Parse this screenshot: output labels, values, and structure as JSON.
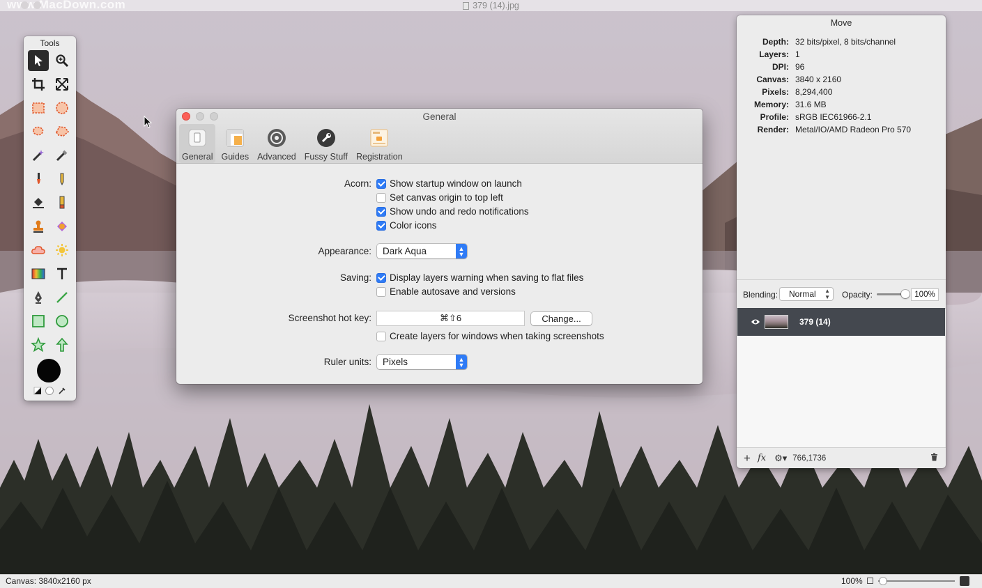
{
  "window": {
    "title": "379 (14).jpg",
    "watermark": "www.MacDown.com"
  },
  "tools": {
    "title": "Tools",
    "items": [
      {
        "name": "move-tool",
        "icon": "arrow-pointer-icon",
        "active": true
      },
      {
        "name": "zoom-tool",
        "icon": "magnifier-icon"
      },
      {
        "name": "crop-tool",
        "icon": "crop-icon"
      },
      {
        "name": "resize-tool",
        "icon": "expand-arrows-icon"
      },
      {
        "name": "rect-select-tool",
        "icon": "rect-selection-icon"
      },
      {
        "name": "ellipse-select-tool",
        "icon": "ellipse-selection-icon"
      },
      {
        "name": "lasso-tool",
        "icon": "lasso-icon"
      },
      {
        "name": "polygon-lasso-tool",
        "icon": "polygon-lasso-icon"
      },
      {
        "name": "magic-wand-tool",
        "icon": "magic-wand-icon"
      },
      {
        "name": "instant-alpha-tool",
        "icon": "wand-alpha-icon"
      },
      {
        "name": "brush-tool",
        "icon": "brush-icon"
      },
      {
        "name": "pencil-tool",
        "icon": "pencil-icon"
      },
      {
        "name": "paint-bucket-tool",
        "icon": "bucket-icon"
      },
      {
        "name": "eraser-tool",
        "icon": "eraser-icon"
      },
      {
        "name": "clone-stamp-tool",
        "icon": "stamp-icon"
      },
      {
        "name": "heal-tool",
        "icon": "bandage-icon"
      },
      {
        "name": "cloud-tool",
        "icon": "cloud-icon"
      },
      {
        "name": "dodge-burn-tool",
        "icon": "sun-icon"
      },
      {
        "name": "gradient-tool",
        "icon": "gradient-icon"
      },
      {
        "name": "text-tool",
        "icon": "text-icon"
      },
      {
        "name": "bezier-tool",
        "icon": "pen-nib-icon"
      },
      {
        "name": "line-tool",
        "icon": "line-icon"
      },
      {
        "name": "rect-shape-tool",
        "icon": "square-icon"
      },
      {
        "name": "oval-shape-tool",
        "icon": "circle-icon"
      },
      {
        "name": "star-tool",
        "icon": "star-icon"
      },
      {
        "name": "arrow-tool",
        "icon": "up-arrow-icon"
      }
    ],
    "foreground_color": "#050505"
  },
  "prefs": {
    "title": "General",
    "tabs": [
      {
        "label": "General",
        "icon": "general-switch-icon",
        "active": true
      },
      {
        "label": "Guides",
        "icon": "guides-icon"
      },
      {
        "label": "Advanced",
        "icon": "gear-dial-icon"
      },
      {
        "label": "Fussy Stuff",
        "icon": "wrench-icon"
      },
      {
        "label": "Registration",
        "icon": "registration-card-icon"
      }
    ],
    "acorn_label": "Acorn:",
    "acorn_options": [
      {
        "label": "Show startup window on launch",
        "checked": true
      },
      {
        "label": "Set canvas origin to top left",
        "checked": false
      },
      {
        "label": "Show undo and redo notifications",
        "checked": true
      },
      {
        "label": "Color icons",
        "checked": true
      }
    ],
    "appearance_label": "Appearance:",
    "appearance_value": "Dark Aqua",
    "saving_label": "Saving:",
    "saving_options": [
      {
        "label": "Display layers warning when saving to flat files",
        "checked": true
      },
      {
        "label": "Enable autosave and versions",
        "checked": false
      }
    ],
    "hotkey_label": "Screenshot hot key:",
    "hotkey_value": "⌘⇧6",
    "change_button": "Change...",
    "windows_option": {
      "label": "Create layers for windows when taking screenshots",
      "checked": false
    },
    "ruler_label": "Ruler units:",
    "ruler_value": "Pixels"
  },
  "info_panel": {
    "title": "Move",
    "rows": [
      {
        "k": "Depth:",
        "v": "32 bits/pixel, 8 bits/channel"
      },
      {
        "k": "Layers:",
        "v": "1"
      },
      {
        "k": "DPI:",
        "v": "96"
      },
      {
        "k": "Canvas:",
        "v": "3840 x 2160"
      },
      {
        "k": "Pixels:",
        "v": "8,294,400"
      },
      {
        "k": "Memory:",
        "v": "31.6 MB"
      },
      {
        "k": "Profile:",
        "v": "sRGB IEC61966-2.1"
      },
      {
        "k": "Render:",
        "v": "Metal/IO/AMD Radeon Pro 570"
      }
    ],
    "blending_label": "Blending:",
    "blending_value": "Normal",
    "opacity_label": "Opacity:",
    "opacity_value": "100%",
    "opacity_level": 1.0,
    "layer_name": "379 (14)",
    "coords": "766,1736"
  },
  "status": {
    "canvas": "Canvas: 3840x2160 px",
    "zoom": "100%"
  },
  "colors": {
    "accent": "#2f7bf6",
    "layer_selected": "#44484f",
    "close": "#fc5f57",
    "inactive_dot": "#d0d0d0"
  }
}
